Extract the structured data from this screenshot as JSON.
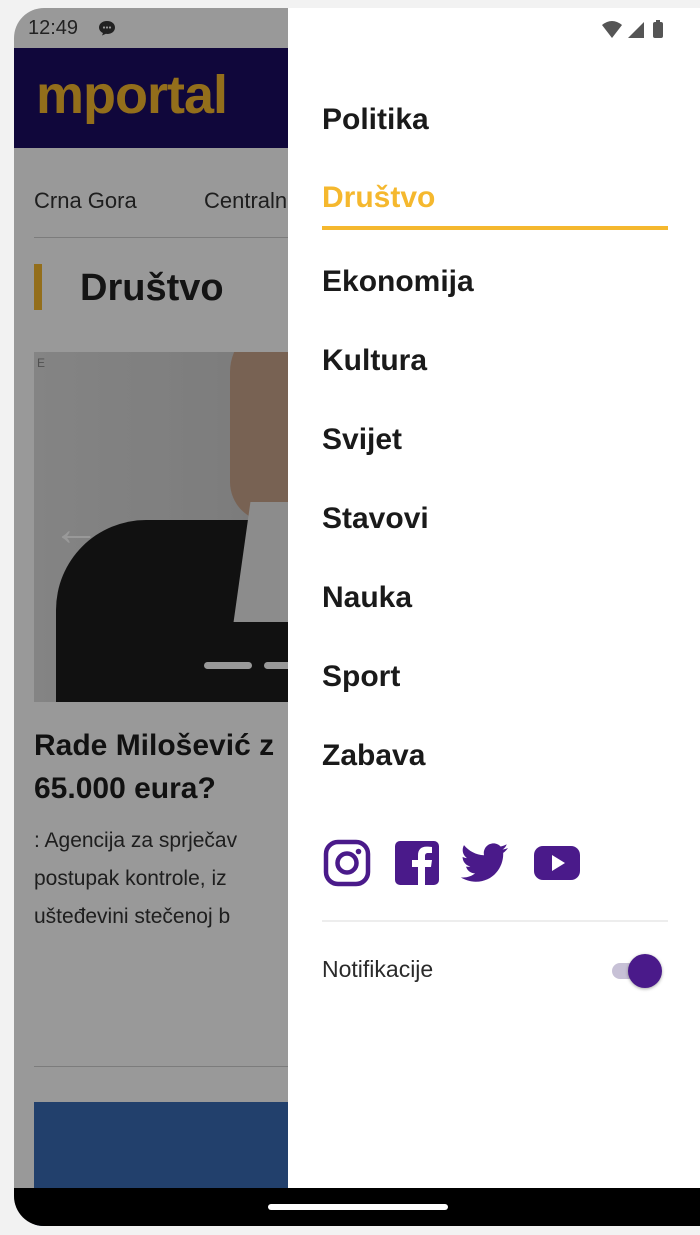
{
  "status_bar": {
    "time": "12:49"
  },
  "app": {
    "logo": "mportal",
    "nav_items": [
      "Crna Gora",
      "Centralna"
    ],
    "section_title": "Društvo",
    "hero": {
      "letter": "E"
    },
    "article": {
      "title_line1": "Rade Milošević z",
      "title_line2": "65.000 eura?",
      "body_line1": ": Agencija za sprječav",
      "body_line2": "postupak kontrole, iz",
      "body_line3": "uštеđevini stečenoj b"
    }
  },
  "drawer": {
    "menu": [
      {
        "label": "Politika",
        "active": false
      },
      {
        "label": "Društvo",
        "active": true
      },
      {
        "label": "Ekonomija",
        "active": false
      },
      {
        "label": "Kultura",
        "active": false
      },
      {
        "label": "Svijet",
        "active": false
      },
      {
        "label": "Stavovi",
        "active": false
      },
      {
        "label": "Nauka",
        "active": false
      },
      {
        "label": "Sport",
        "active": false
      },
      {
        "label": "Zabava",
        "active": false
      }
    ],
    "social_icons": [
      "instagram-icon",
      "facebook-icon",
      "twitter-icon",
      "youtube-icon"
    ],
    "notifications_label": "Notifikacije",
    "notifications_enabled": true
  },
  "colors": {
    "accent_gold": "#f5b82e",
    "brand_purple": "#4a1a8a",
    "header_navy": "#1b0c63"
  }
}
